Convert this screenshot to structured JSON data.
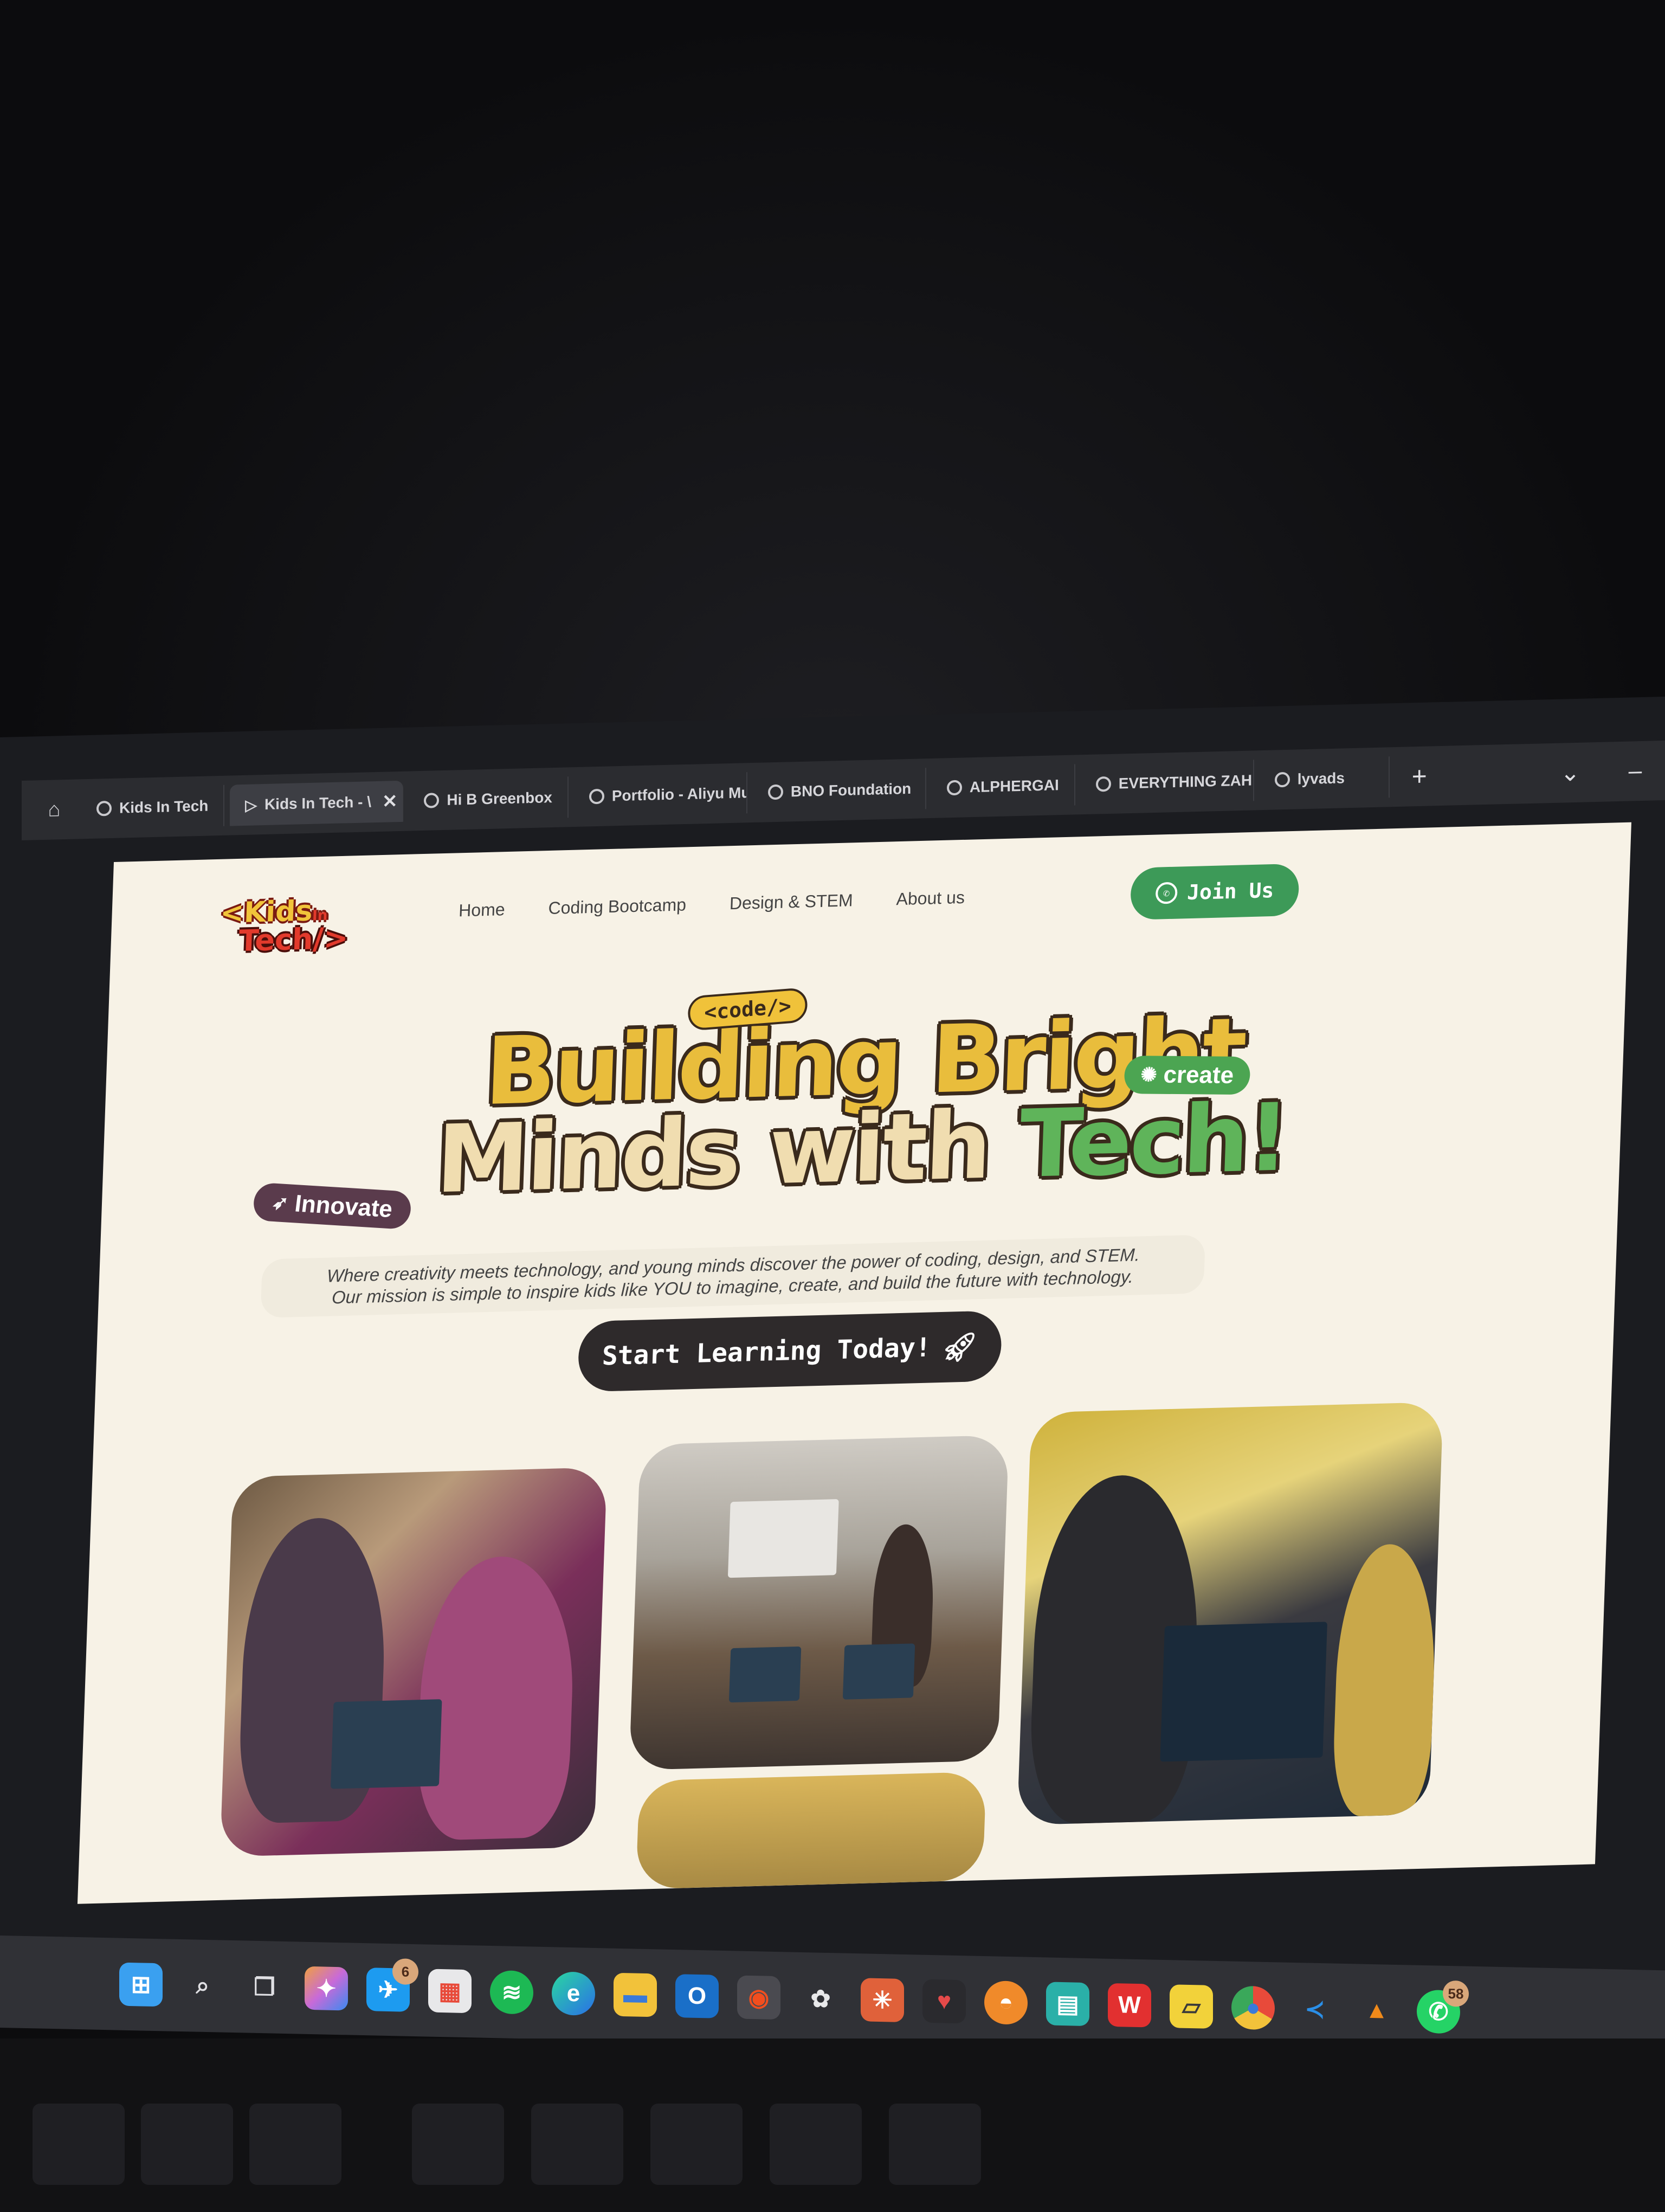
{
  "browser": {
    "tabs": [
      {
        "label": "Kids In Tech",
        "active": false
      },
      {
        "label": "Kids In Tech - \\",
        "active": true
      },
      {
        "label": "Hi B Greenbox",
        "active": false
      },
      {
        "label": "Portfolio - Aliyu Mu",
        "active": false
      },
      {
        "label": "BNO Foundation",
        "active": false
      },
      {
        "label": "ALPHERGAI",
        "active": false
      },
      {
        "label": "EVERYTHING ZAHI",
        "active": false
      },
      {
        "label": "lyvads",
        "active": false
      }
    ],
    "new_tab_label": "+",
    "close_tab_label": "✕",
    "dropdown_label": "⌄",
    "minimize_label": "–"
  },
  "site": {
    "logo": {
      "top": "<Kids",
      "in": "In",
      "bottom": "Tech/>"
    },
    "nav": [
      "Home",
      "Coding Bootcamp",
      "Design & STEM",
      "About us"
    ],
    "join_button": "Join Us",
    "hero": {
      "line1_a": "Building",
      "line1_b": "Bright",
      "line2_a": "Minds",
      "line2_b": "with",
      "line2_c": "Tech!",
      "tag_code": "<code/>",
      "tag_create": "create",
      "tag_innovate": "Innovate",
      "subtitle_line1": "Where creativity meets technology, and young minds discover the power of coding, design, and STEM.",
      "subtitle_line2": "Our mission is simple to inspire kids like YOU to imagine, create, and build the future with technology.",
      "cta": "Start Learning Today!"
    }
  },
  "taskbar": {
    "icons": [
      {
        "name": "windows-start-icon",
        "color": "#3aa0f0"
      },
      {
        "name": "search-icon",
        "color": "#d0d0d4"
      },
      {
        "name": "task-view-icon",
        "color": "#bfbfc4"
      },
      {
        "name": "copilot-icon",
        "color": "#c86ad8"
      },
      {
        "name": "twitter-icon",
        "color": "#1d9bf0",
        "badge": "6"
      },
      {
        "name": "microsoft-store-icon",
        "color": "#e8e8ea"
      },
      {
        "name": "spotify-icon",
        "color": "#1db954"
      },
      {
        "name": "edge-icon",
        "color": "#2a8fd8"
      },
      {
        "name": "file-explorer-icon",
        "color": "#f2c23a"
      },
      {
        "name": "outlook-icon",
        "color": "#1a6fc8"
      },
      {
        "name": "figma-icon",
        "color": "#f24e1e"
      },
      {
        "name": "chatgpt-icon",
        "color": "#e8e8ea"
      },
      {
        "name": "claude-icon",
        "color": "#e0613a"
      },
      {
        "name": "heart-app-icon",
        "color": "#e64a4a"
      },
      {
        "name": "sunset-app-icon",
        "color": "#f08a2a"
      },
      {
        "name": "teal-app-icon",
        "color": "#2ab0a8"
      },
      {
        "name": "wps-office-icon",
        "color": "#e23030"
      },
      {
        "name": "sticky-notes-icon",
        "color": "#f2d23a"
      },
      {
        "name": "chrome-icon",
        "color": "#e84a3a"
      },
      {
        "name": "vscode-icon",
        "color": "#2a8fe8"
      },
      {
        "name": "vlc-icon",
        "color": "#f08a1a"
      },
      {
        "name": "whatsapp-icon",
        "color": "#25d366",
        "badge": "58"
      }
    ]
  },
  "colors": {
    "accent_green": "#3d9a58",
    "hero_yellow": "#e9bd3c",
    "hero_cream": "#f0ddb0",
    "hero_green": "#5fb45a",
    "page_bg": "#f7f2e6"
  }
}
